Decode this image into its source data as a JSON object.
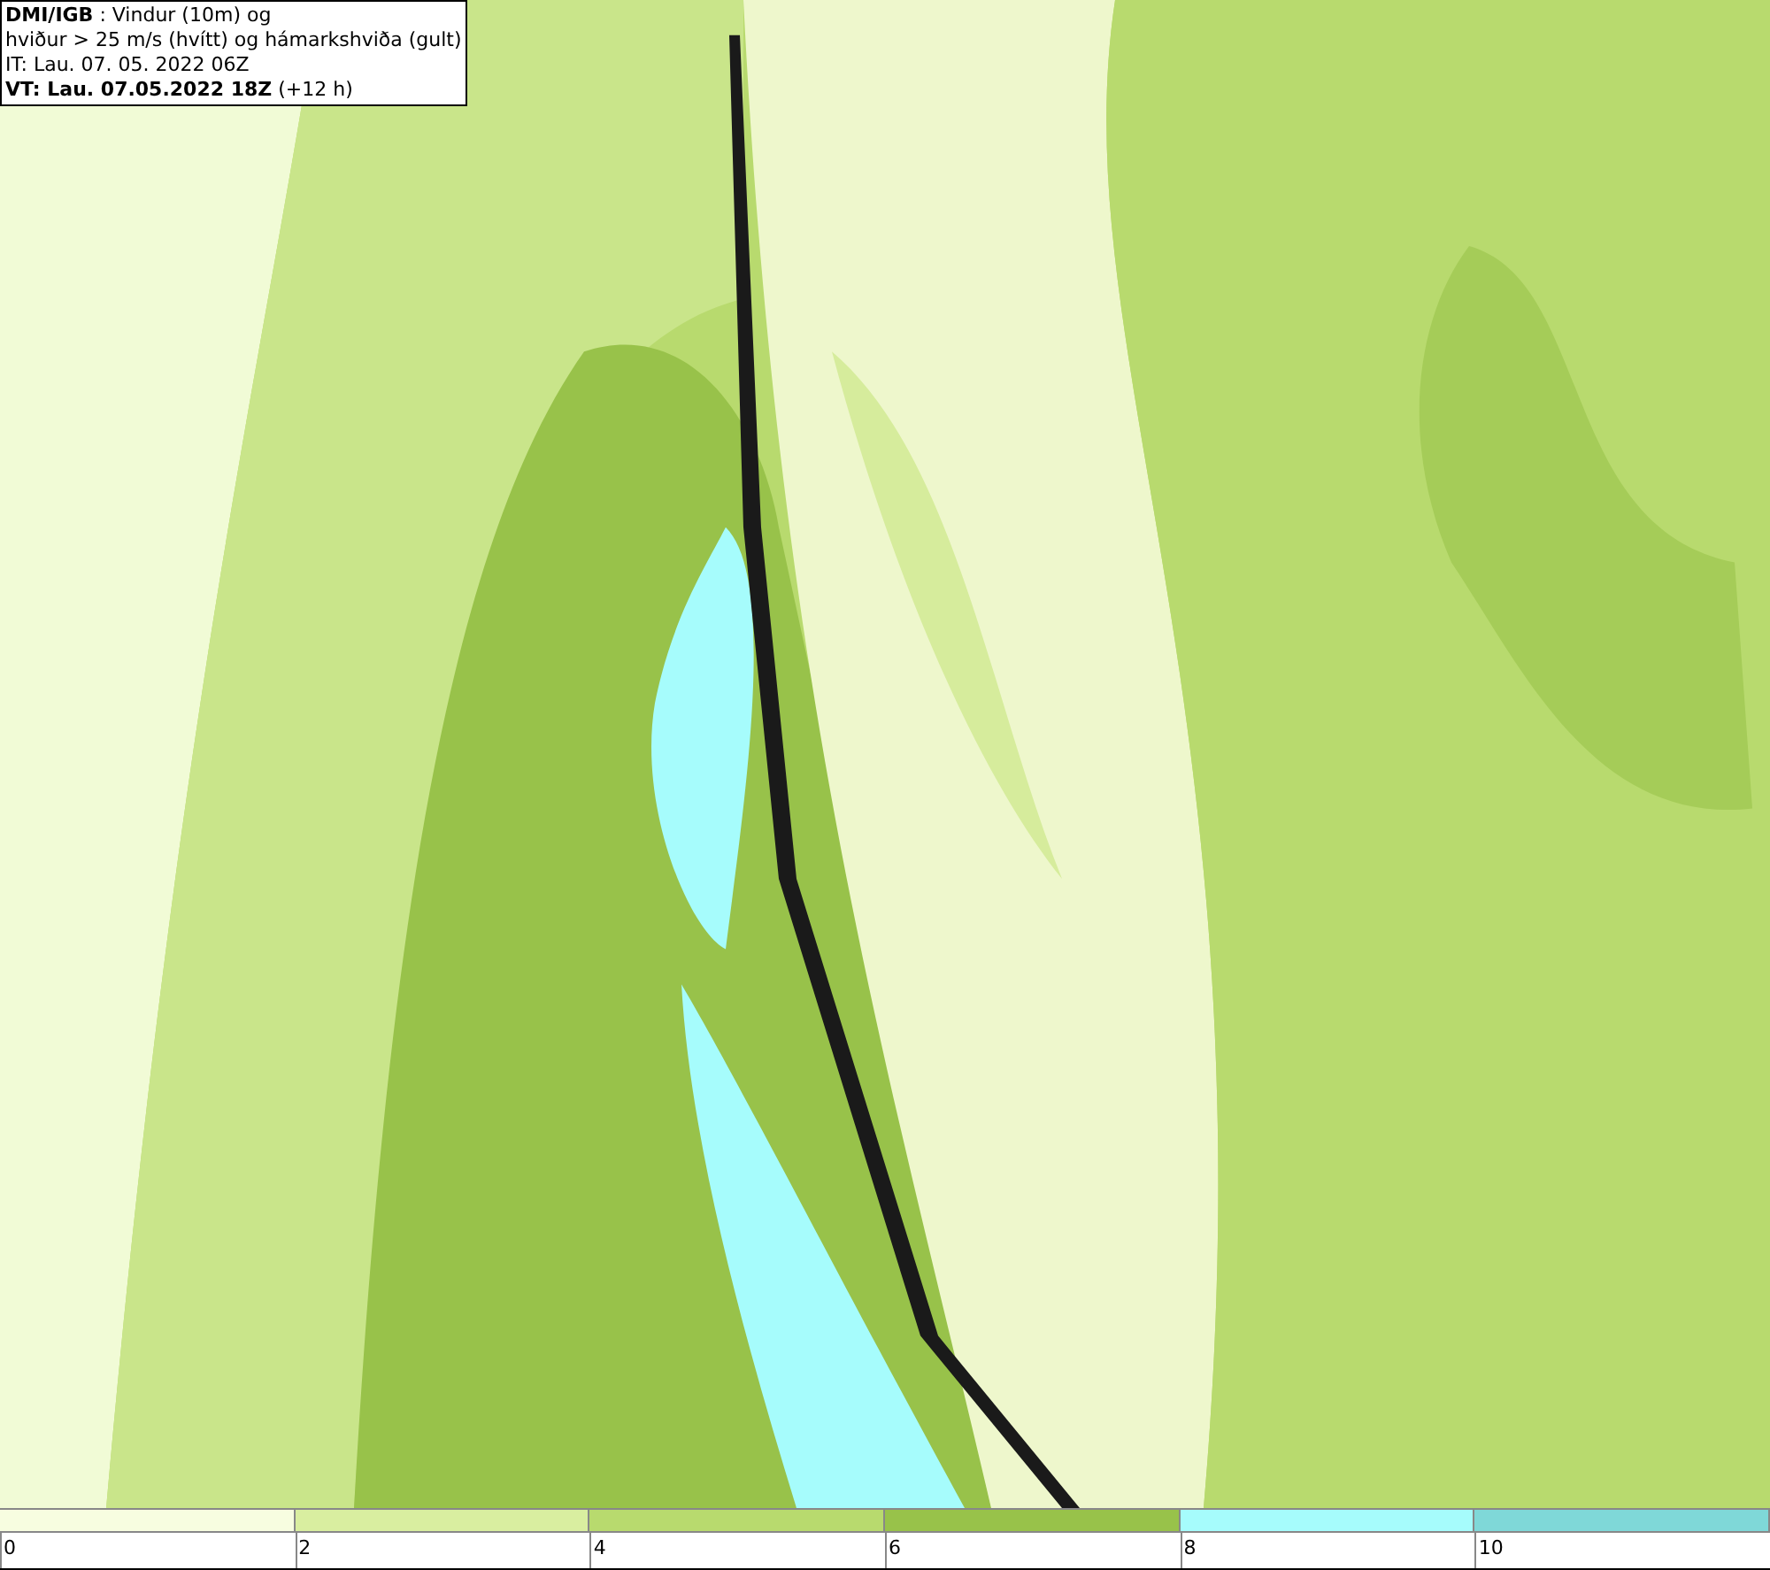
{
  "info_box": {
    "lines": [
      "**DMI/IGB** : Vindur (10m) og",
      "hviður > 25 m/s (hvítt) og hámarkshviða (gult)",
      "IT: Lau. 07. 05. 2022 06Z",
      "**VT: Lau. 07.05.2022 18Z** (+12 h)"
    ]
  },
  "legend": {
    "segments": [
      {
        "color": "#f7fde0"
      },
      {
        "color": "#d9eea0"
      },
      {
        "color": "#b8da6e"
      },
      {
        "color": "#98c24a"
      },
      {
        "color": "#a6fcfc"
      },
      {
        "color": "#7fd8d8"
      }
    ],
    "labels": [
      "0",
      "2",
      "4",
      "6",
      "8",
      "10"
    ]
  }
}
